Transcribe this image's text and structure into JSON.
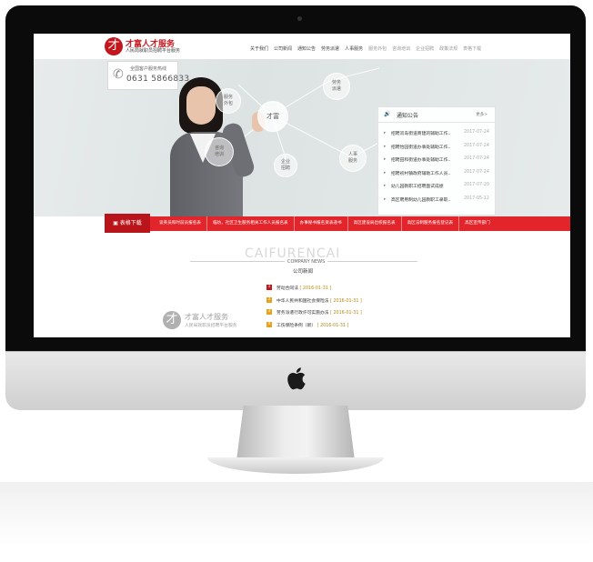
{
  "site": {
    "logo_mark": "才",
    "logo_name": "才富人才服务",
    "logo_sub": "人民局就职员招聘平台服务",
    "nav": [
      {
        "label": "关于我们",
        "muted": false
      },
      {
        "label": "公司新闻",
        "muted": false
      },
      {
        "label": "通知公告",
        "muted": false
      },
      {
        "label": "劳务派遣",
        "muted": false
      },
      {
        "label": "人事服务",
        "muted": false
      },
      {
        "label": "服务外包",
        "muted": true
      },
      {
        "label": "咨询培训",
        "muted": true
      },
      {
        "label": "企业招聘",
        "muted": true
      },
      {
        "label": "政策法规",
        "muted": true
      },
      {
        "label": "表格下载",
        "muted": true
      }
    ]
  },
  "hero": {
    "hotline_label": "全国客户服务热线",
    "hotline_number": "0631 5866833",
    "bubbles": {
      "main": "才富",
      "outsourcing": "服务\n外包",
      "dispatch": "劳务\n派遣",
      "training": "咨询\n培训",
      "recruit": "企业\n招聘",
      "hr": "人事\n服务"
    }
  },
  "notice": {
    "title": "通知公告",
    "more": "更多>",
    "items": [
      {
        "title": "招聘双岛街道商建的辅助工作…",
        "date": "2017-07-24"
      },
      {
        "title": "招聘怡园街道办事处辅助工作…",
        "date": "2017-07-24"
      },
      {
        "title": "招聘田和街道办事处辅助工作…",
        "date": "2017-07-24"
      },
      {
        "title": "招聘初村镇政府辅助工作人员…",
        "date": "2017-07-24"
      },
      {
        "title": "幼儿园教职工招聘面试成绩",
        "date": "2017-07-20"
      },
      {
        "title": "高区聘用制幼儿园教职工录取…",
        "date": "2017-05-12"
      }
    ]
  },
  "redbar": {
    "download_label": "表格下载",
    "links": [
      "谈英员和时前员报名表",
      "临坊，社区卫生服务相关工作人员报名表",
      "办事秘书报名资表递书",
      "高区建设局出校报名表",
      "高区法制服务报名登记表",
      "高区宣传部门"
    ]
  },
  "news": {
    "watermark": "CAIFURENCAI",
    "title_en": "COMPANY NEWS",
    "title_cn": "公司新闻",
    "items": [
      {
        "num": "1",
        "title": "劳动合同法",
        "date": "2016-01-31",
        "color": "#c5161d"
      },
      {
        "num": "2",
        "title": "中华人民共和国社会保险法",
        "date": "2016-01-31",
        "color": "#e8a11a"
      },
      {
        "num": "3",
        "title": "劳务派遣行政许可实施办法",
        "date": "2016-01-31",
        "color": "#e8a11a"
      },
      {
        "num": "4",
        "title": "工伤保险条例（新）",
        "date": "2016-01-31",
        "color": "#e8a11a"
      }
    ]
  },
  "footer_logo": {
    "mark": "才",
    "name": "才富人才服务",
    "sub": "人民局就职员招聘平台服务"
  },
  "colors": {
    "brand_red": "#c5161d",
    "bar_red": "#e2242b",
    "accent_orange": "#e8a11a"
  }
}
